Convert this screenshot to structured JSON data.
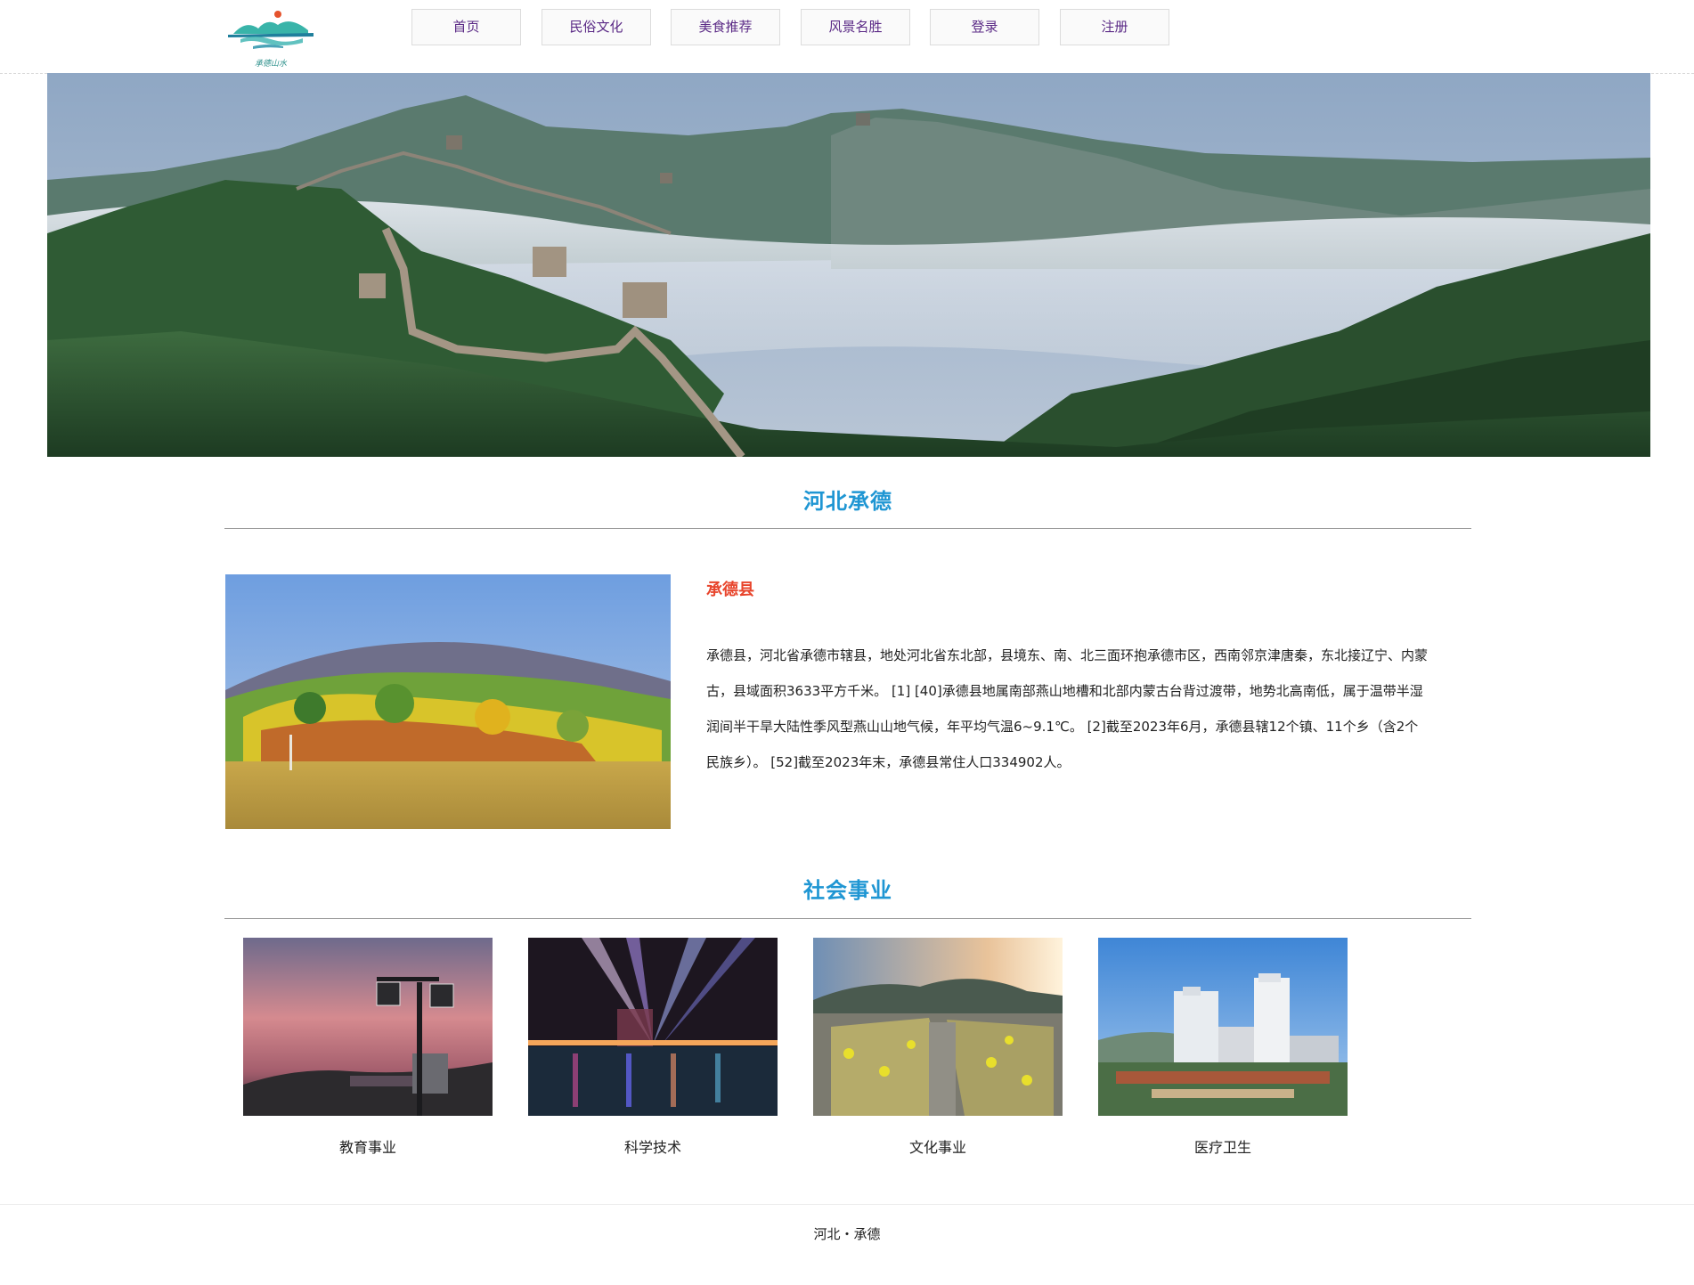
{
  "brand": {
    "logo_text": "承德山水"
  },
  "nav": {
    "items": [
      {
        "label": "首页"
      },
      {
        "label": "民俗文化"
      },
      {
        "label": "美食推荐"
      },
      {
        "label": "风景名胜"
      },
      {
        "label": "登录"
      },
      {
        "label": "注册"
      }
    ]
  },
  "intro": {
    "section_title": "河北承德",
    "heading": "承德县",
    "paragraph": "承德县，河北省承德市辖县，地处河北省东北部，县境东、南、北三面环抱承德市区，西南邻京津唐秦，东北接辽宁、内蒙古，县域面积3633平方千米。 [1] [40]承德县地属南部燕山地槽和北部内蒙古台背过渡带，地势北高南低，属于温带半湿润间半干旱大陆性季风型燕山山地气候，年平均气温6~9.1℃。 [2]截至2023年6月，承德县辖12个镇、11个乡（含2个民族乡）。 [52]截至2023年末，承德县常住人口334902人。"
  },
  "social": {
    "section_title": "社会事业",
    "cards": [
      {
        "label": "教育事业"
      },
      {
        "label": "科学技术"
      },
      {
        "label": "文化事业"
      },
      {
        "label": "医疗卫生"
      }
    ]
  },
  "footer": {
    "text": "河北・承德"
  },
  "colors": {
    "nav_text": "#5b2a86",
    "section_title": "#1f96d3",
    "intro_heading": "#e8452c"
  }
}
